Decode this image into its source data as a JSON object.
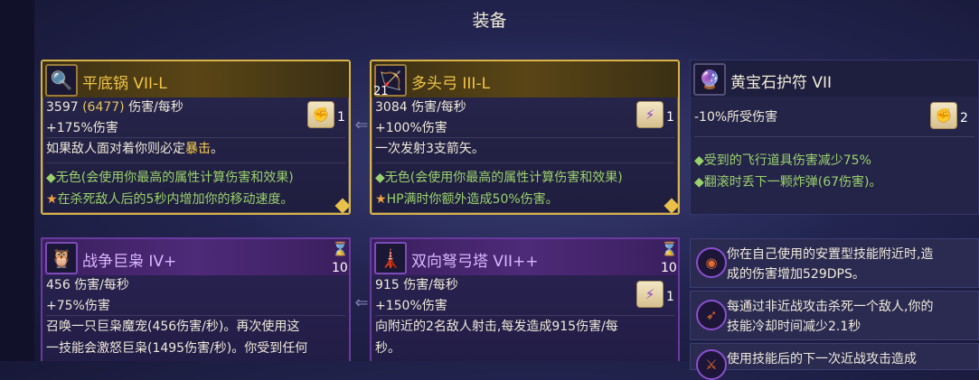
{
  "title": "装备",
  "cards": {
    "pan": {
      "name": "平底锅 VII-L",
      "dps_value": "3597",
      "dps_alt": "(6477)",
      "dps_unit": "伤害/每秒",
      "bonus": "+175%伤害",
      "desc_prefix": "如果敌人面对着你则必定",
      "desc_crit": "暴击",
      "desc_suffix": "。",
      "trait1": "◆无色(会使用你最高的属性计算伤害和效果)",
      "trait2_icon": "★",
      "trait2": "在杀死敌人后的5秒内增加你的移动速度。",
      "rune_count": "1",
      "icon": "magnifier-pan-icon"
    },
    "bow": {
      "name": "多头弓 III-L",
      "icon_count": "21",
      "dps_value": "3084",
      "dps_unit": "伤害/每秒",
      "bonus": "+100%伤害",
      "desc": "一次发射3支箭矢。",
      "trait1": "◆无色(会使用你最高的属性计算伤害和效果)",
      "trait2_icon": "★",
      "trait2": "HP满时你额外造成50%伤害。",
      "rune_count": "1",
      "icon": "bow-icon"
    },
    "amulet": {
      "name": "黄宝石护符 VII",
      "stat": "-10%所受伤害",
      "trait1": "◆受到的飞行道具伤害减少75%",
      "trait2": "◆翻滚时丢下一颗炸弹(67伤害)。",
      "rune_count": "2",
      "icon": "amulet-icon"
    },
    "owl": {
      "name": "战争巨枭 IV+",
      "dps_value": "456",
      "dps_unit": "伤害/每秒",
      "bonus": "+75%伤害",
      "desc1": "召唤一只巨枭魔宠(456伤害/秒)。再次使用这",
      "desc2": "一技能会激怒巨枭(1495伤害/秒)。你受到任何",
      "cooldown": "10",
      "icon": "owl-icon"
    },
    "turret": {
      "name": "双向弩弓塔 VII++",
      "dps_value": "915",
      "dps_unit": "伤害/每秒",
      "bonus": "+150%伤害",
      "desc1": "向附近的2名敌人射击,每发造成915伤害/每",
      "desc2": "秒。",
      "cooldown": "10",
      "rune_count": "1",
      "icon": "crossbow-turret-icon"
    }
  },
  "passives": [
    {
      "line1": "你在自己使用的安置型技能附近时,造",
      "line2": "成的伤害增加529DPS。",
      "icon": "eye-rune-icon"
    },
    {
      "line1": "每通过非近战攻击杀死一个敌人,你的",
      "line2": "技能冷却时间减少2.1秒",
      "icon": "arrow-rune-icon"
    },
    {
      "line1": "使用技能后的下一次近战攻击造成",
      "line2": "",
      "icon": "sword-rune-icon"
    }
  ],
  "colors": {
    "gold_border": "#d9b34a",
    "purple_border": "#6a3aa0",
    "crit": "#ffd24a",
    "green": "#9ad26a"
  }
}
